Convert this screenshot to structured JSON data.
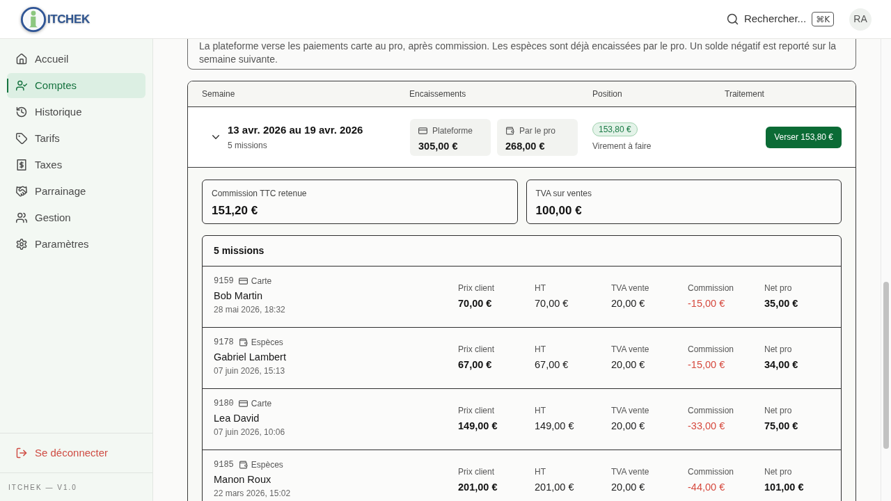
{
  "header": {
    "logo": {
      "text": "ITCHEK"
    },
    "search": {
      "label": "Rechercher...",
      "shortcut": "⌘K"
    },
    "avatar": {
      "initials": "RA"
    }
  },
  "sidebar": {
    "items": [
      {
        "label": "Accueil",
        "selected": false
      },
      {
        "label": "Comptes",
        "selected": true
      },
      {
        "label": "Historique",
        "selected": false
      },
      {
        "label": "Tarifs",
        "selected": false
      },
      {
        "label": "Taxes",
        "selected": false
      },
      {
        "label": "Parrainage",
        "selected": false
      },
      {
        "label": "Gestion",
        "selected": false
      },
      {
        "label": "Paramètres",
        "selected": false
      }
    ],
    "logout": {
      "label": "Se déconnecter"
    },
    "footer": "ITCHEK — V1.0"
  },
  "info": {
    "text": "La plateforme verse les paiements carte au pro, après commission. Les espèces sont déjà encaissées par le pro. Un solde négatif est reporté sur la semaine suivante."
  },
  "table": {
    "columns": [
      "Semaine",
      "Encaissements",
      "Position",
      "Traitement"
    ],
    "week": {
      "expanded": true,
      "title": "13 avr. 2026 au 19 avr. 2026",
      "subtitle": "5 missions",
      "collections": [
        {
          "kind": "card",
          "label": "Plateforme",
          "amount": "305,00 €"
        },
        {
          "kind": "cash",
          "label": "Par le pro",
          "amount": "268,00 €"
        }
      ],
      "position": {
        "badge": "153,80 €",
        "note": "Virement à faire"
      },
      "action": "Verser 153,80 €",
      "summary": [
        {
          "label": "Commission TTC retenue",
          "value": "151,20 €"
        },
        {
          "label": "TVA sur ventes",
          "value": "100,00 €"
        }
      ],
      "missions": {
        "title": "5 missions",
        "rows": [
          {
            "id": "9159",
            "method": {
              "kind": "card",
              "label": "Carte"
            },
            "client": "Bob Martin",
            "date": "28 mai 2026, 18:32",
            "figures": [
              {
                "label": "Prix client",
                "value": "70,00 €",
                "kind": "strong"
              },
              {
                "label": "HT",
                "value": "70,00 €",
                "kind": "plain"
              },
              {
                "label": "TVA vente",
                "value": "20,00 €",
                "kind": "plain"
              },
              {
                "label": "Commission",
                "value": "-15,00 €",
                "kind": "negative"
              },
              {
                "label": "Net pro",
                "value": "35,00 €",
                "kind": "strong"
              }
            ]
          },
          {
            "id": "9178",
            "method": {
              "kind": "cash",
              "label": "Espèces"
            },
            "client": "Gabriel Lambert",
            "date": "07 juin 2026, 15:13",
            "figures": [
              {
                "label": "Prix client",
                "value": "67,00 €",
                "kind": "strong"
              },
              {
                "label": "HT",
                "value": "67,00 €",
                "kind": "plain"
              },
              {
                "label": "TVA vente",
                "value": "20,00 €",
                "kind": "plain"
              },
              {
                "label": "Commission",
                "value": "-15,00 €",
                "kind": "negative"
              },
              {
                "label": "Net pro",
                "value": "34,00 €",
                "kind": "strong"
              }
            ]
          },
          {
            "id": "9180",
            "method": {
              "kind": "card",
              "label": "Carte"
            },
            "client": "Lea David",
            "date": "07 juin 2026, 10:06",
            "figures": [
              {
                "label": "Prix client",
                "value": "149,00 €",
                "kind": "strong"
              },
              {
                "label": "HT",
                "value": "149,00 €",
                "kind": "plain"
              },
              {
                "label": "TVA vente",
                "value": "20,00 €",
                "kind": "plain"
              },
              {
                "label": "Commission",
                "value": "-33,00 €",
                "kind": "negative"
              },
              {
                "label": "Net pro",
                "value": "75,00 €",
                "kind": "strong"
              }
            ]
          },
          {
            "id": "9185",
            "method": {
              "kind": "cash",
              "label": "Espèces"
            },
            "client": "Manon Roux",
            "date": "22 mars 2026, 15:02",
            "figures": [
              {
                "label": "Prix client",
                "value": "201,00 €",
                "kind": "strong"
              },
              {
                "label": "HT",
                "value": "201,00 €",
                "kind": "plain"
              },
              {
                "label": "TVA vente",
                "value": "20,00 €",
                "kind": "plain"
              },
              {
                "label": "Commission",
                "value": "-44,00 €",
                "kind": "negative"
              },
              {
                "label": "Net pro",
                "value": "101,00 €",
                "kind": "strong"
              }
            ]
          }
        ]
      }
    }
  }
}
